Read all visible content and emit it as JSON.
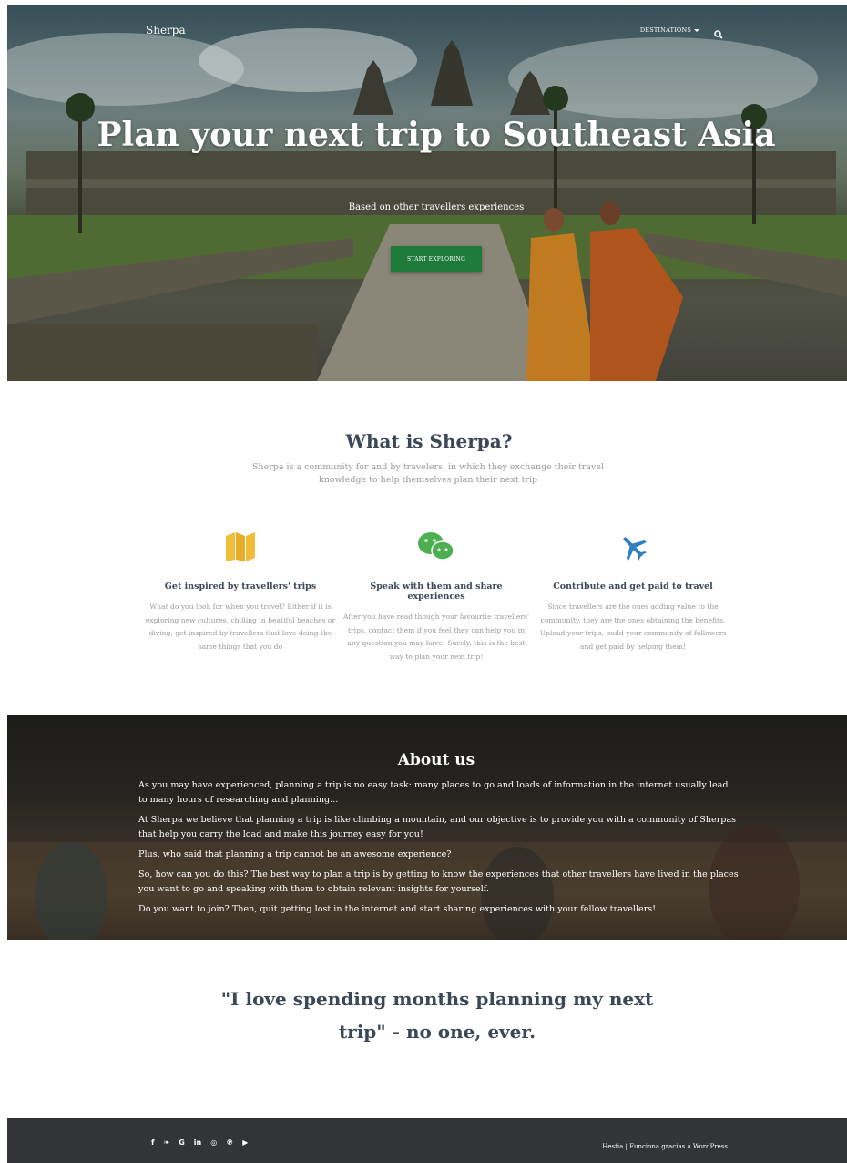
{
  "header": {
    "brand": "Sherpa",
    "nav_destinations": "DESTINATIONS",
    "search_icon": "search-icon"
  },
  "hero": {
    "title": "Plan your next trip to Southeast Asia",
    "subtitle": "Based on other travellers experiences",
    "cta_label": "START EXPLORING"
  },
  "what": {
    "title": "What is Sherpa?",
    "description": "Sherpa is a community for and by travelers, in which they exchange their travel knowledge to help themselves plan their next trip",
    "features": [
      {
        "icon": "map-icon",
        "color": "#f0bd3a",
        "title": "Get inspired by travellers' trips",
        "text": "What do you look for when you travel? Either if it is exploring new cultures, chilling in beatiful beaches or diving, get inspired by travellers that love doing the same things that you do"
      },
      {
        "icon": "wechat-icon",
        "color": "#4caf50",
        "title": "Speak with them and share experiences",
        "text": "After you have read though your favourite travellers' trips, contact them if you feel they can help you in any question you may have! Surely, this is the best way to plan your next trip!"
      },
      {
        "icon": "plane-icon",
        "color": "#2f7fc1",
        "title": "Contribute and get paid to travel",
        "text": "Since travellers are the ones adding value to the community, they are the ones obtaining the benefits. Upload your trips, build your community of followers and get paid by helping them!"
      }
    ]
  },
  "about": {
    "title": "About us",
    "paragraphs": [
      "As you may have experienced, planning a trip is no easy task: many places to go and loads of information in the internet usually lead to many hours of researching and planning...",
      "At Sherpa we believe that planning a trip is like climbing a mountain, and our objective is to provide you with a community of Sherpas that help you carry the load and make this journey easy for you!",
      "Plus, who said that planning a trip cannot be an awesome experience?",
      "So, how can you do this? The best way to plan a trip is by getting to know the experiences that other travellers have lived in the places you want to go and speaking with them to obtain relevant insights for yourself.",
      "Do you want to join? Then, quit getting lost in the internet and start sharing experiences with your fellow travellers!"
    ]
  },
  "quote": {
    "text": "\"I love spending months planning my next trip\" - no one, ever."
  },
  "footer": {
    "socials": [
      {
        "icon": "facebook-icon",
        "glyph": "f"
      },
      {
        "icon": "twitter-icon",
        "glyph": "❧"
      },
      {
        "icon": "google-icon",
        "glyph": "G"
      },
      {
        "icon": "linkedin-icon",
        "glyph": "in"
      },
      {
        "icon": "instagram-icon",
        "glyph": "◎"
      },
      {
        "icon": "pinterest-icon",
        "glyph": "℗"
      },
      {
        "icon": "youtube-icon",
        "glyph": "▶"
      }
    ],
    "credit": "Hestia | Funciona gracias a WordPress"
  }
}
